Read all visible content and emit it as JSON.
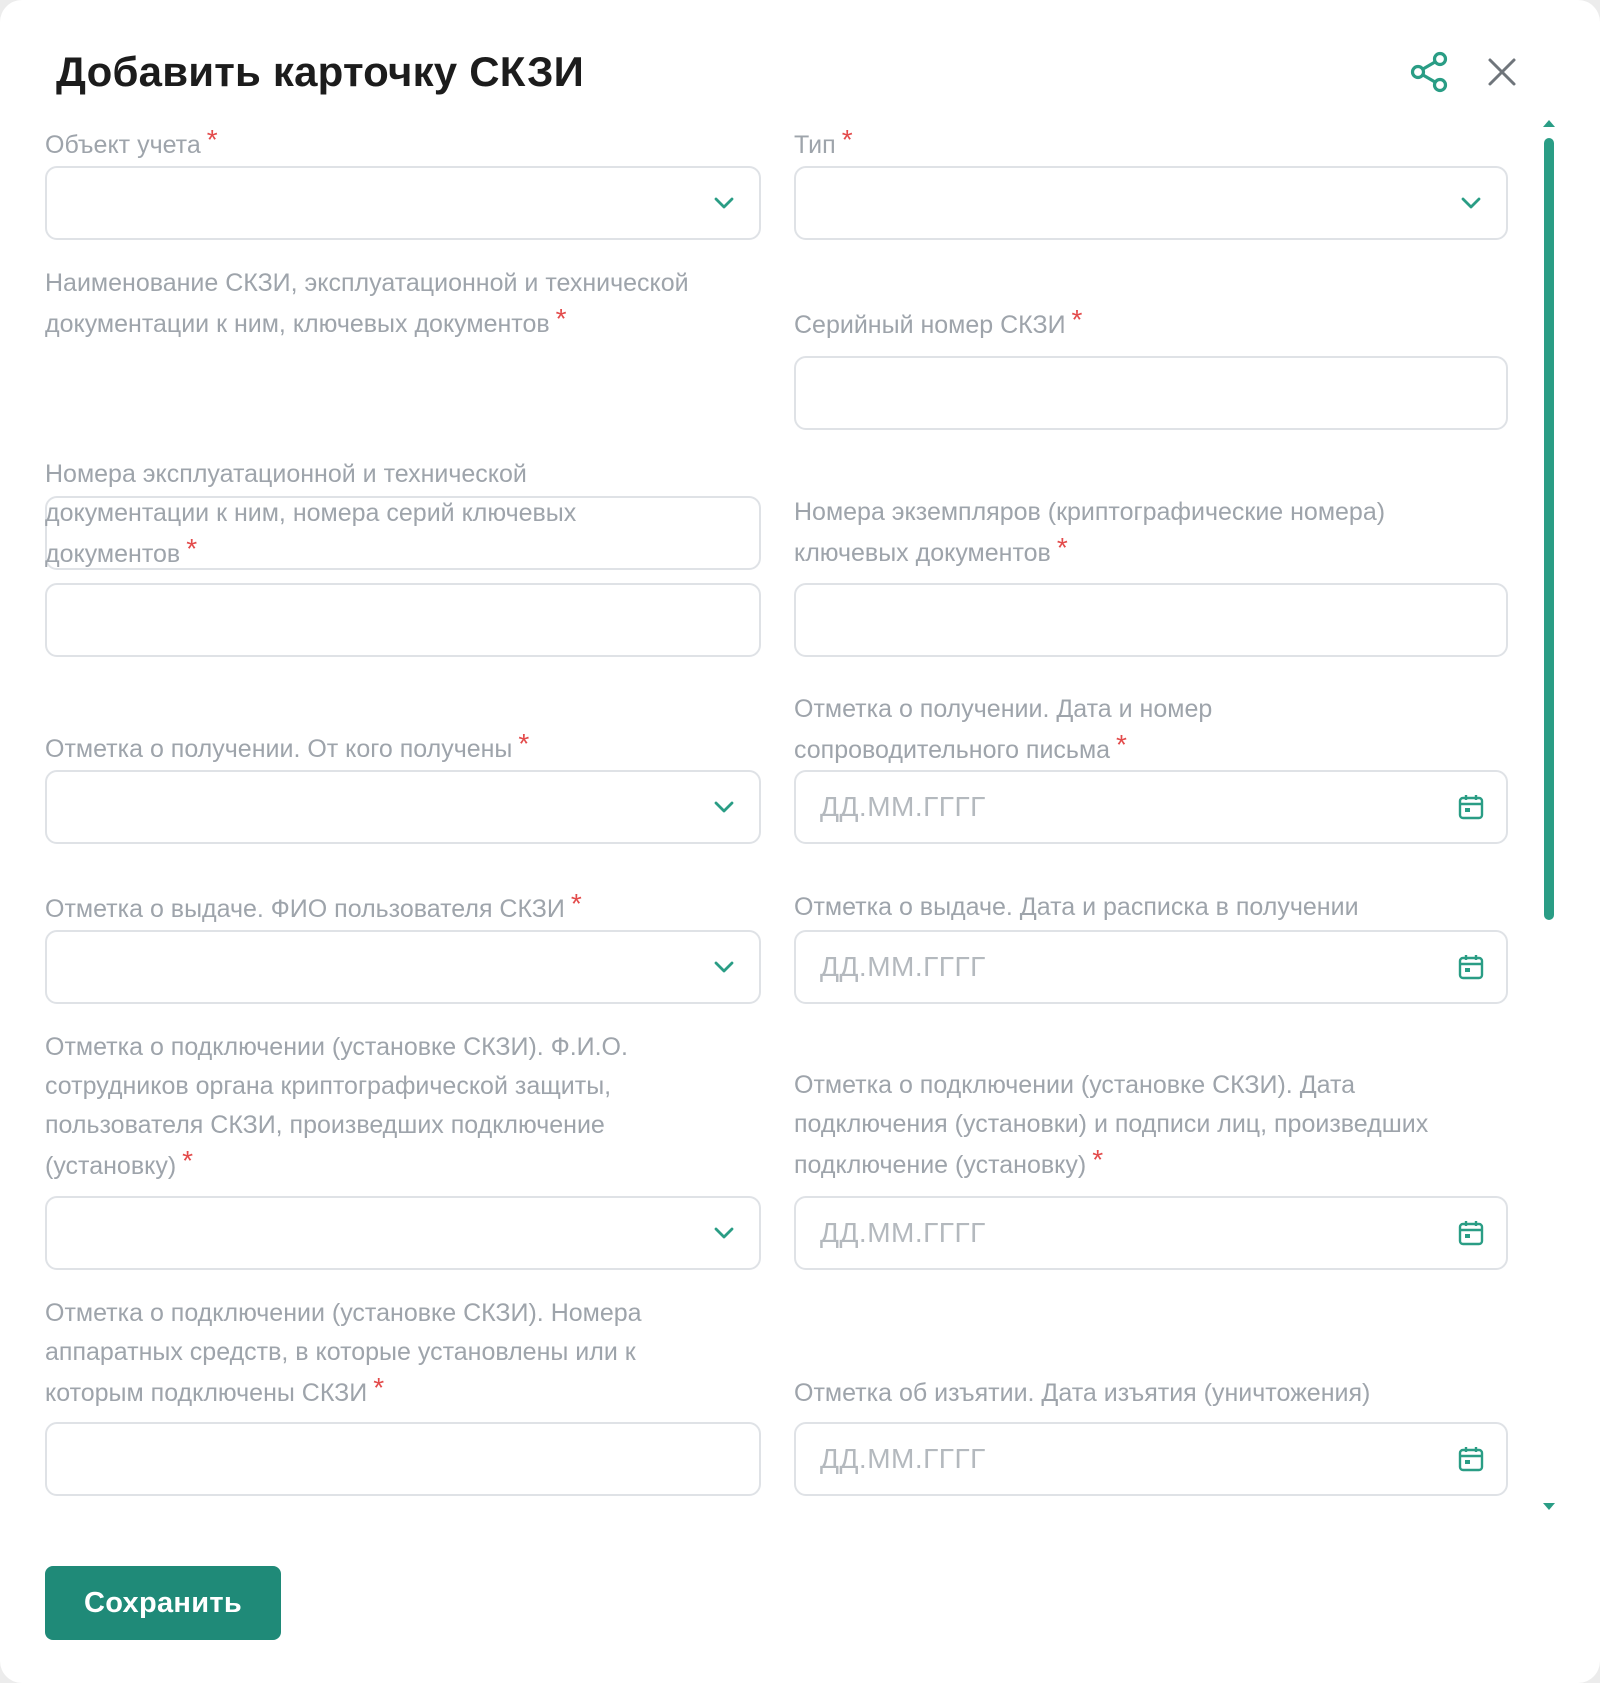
{
  "dialog": {
    "title": "Добавить карточку СКЗИ"
  },
  "colors": {
    "accent": "#1f8a78",
    "required": "#e34b4b",
    "label": "#9ea4ab",
    "border": "#dfe2e6"
  },
  "fields": {
    "accounting_object": {
      "label": "Объект учета",
      "required": "*"
    },
    "type": {
      "label": "Тип",
      "required": "*"
    },
    "name": {
      "label_line1": "Наименование СКЗИ, эксплуатационной и технической",
      "label_line2": "документации к ним, ключевых документов",
      "required": "*"
    },
    "serial_number": {
      "label": "Серийный номер СКЗИ",
      "required": "*"
    },
    "doc_numbers": {
      "label_line1": "Номера эксплуатационной и технической",
      "label_line2": "документации к ним, номера серий ключевых",
      "label_line3": "документов",
      "required": "*"
    },
    "copy_numbers": {
      "label_line1": "Номера экземпляров (криптографические номера)",
      "label_line2": "ключевых документов",
      "required": "*"
    },
    "received_from": {
      "label": "Отметка о получении. От кого получены",
      "required": "*"
    },
    "received_date": {
      "label_line1": "Отметка о получении. Дата и номер",
      "label_line2": "сопроводительного письма",
      "required": "*",
      "placeholder": "ДД.ММ.ГГГГ"
    },
    "issued_user": {
      "label": "Отметка о выдаче. ФИО пользователя СКЗИ",
      "required": "*"
    },
    "issued_date": {
      "label": "Отметка о выдаче. Дата и расписка в получении",
      "placeholder": "ДД.ММ.ГГГГ"
    },
    "install_staff": {
      "label_line1": "Отметка о подключении (установке СКЗИ). Ф.И.О.",
      "label_line2": "сотрудников органа криптографической защиты,",
      "label_line3": "пользователя СКЗИ, произведших подключение",
      "label_line4": "(установку)",
      "required": "*"
    },
    "install_date": {
      "label_line1": "Отметка о подключении (установке СКЗИ). Дата",
      "label_line2": "подключения (установки) и подписи лиц, произведших",
      "label_line3": "подключение (установку)",
      "required": "*",
      "placeholder": "ДД.ММ.ГГГГ"
    },
    "hardware_numbers": {
      "label_line1": "Отметка о подключении (установке СКЗИ). Номера",
      "label_line2": "аппаратных средств, в которые установлены или к",
      "label_line3": "которым подключены СКЗИ",
      "required": "*"
    },
    "withdrawal_date": {
      "label": "Отметка об изъятии. Дата изъятия (уничтожения)",
      "placeholder": "ДД.ММ.ГГГГ"
    }
  },
  "actions": {
    "save_label": "Сохранить"
  },
  "icons": {
    "share": "share-icon",
    "close": "close-icon",
    "chevron": "chevron-down-icon",
    "calendar": "calendar-icon"
  }
}
